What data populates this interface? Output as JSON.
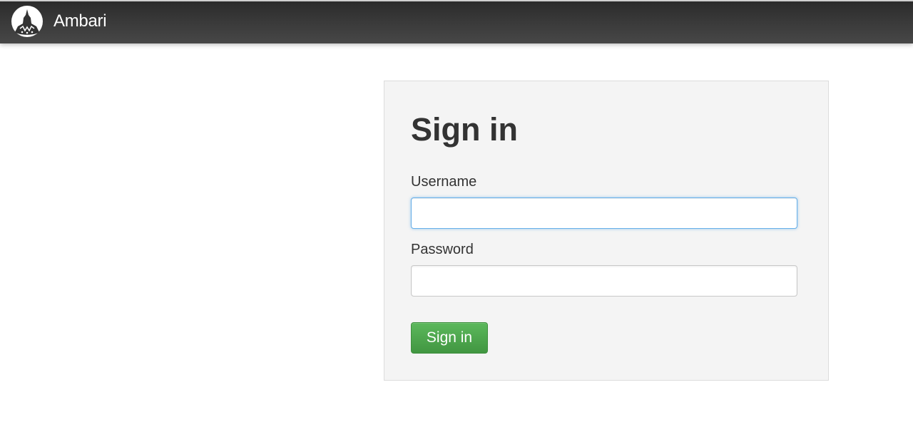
{
  "app": {
    "brand_name": "Ambari",
    "logo_icon": "ambari-logo-icon"
  },
  "login": {
    "title": "Sign in",
    "username_label": "Username",
    "username_value": "",
    "password_label": "Password",
    "password_value": "",
    "submit_label": "Sign in"
  },
  "colors": {
    "navbar": "#3a3a3a",
    "panel_background": "#f4f4f4",
    "focus_border": "#66afe9",
    "button_green": "#5cb85c"
  }
}
